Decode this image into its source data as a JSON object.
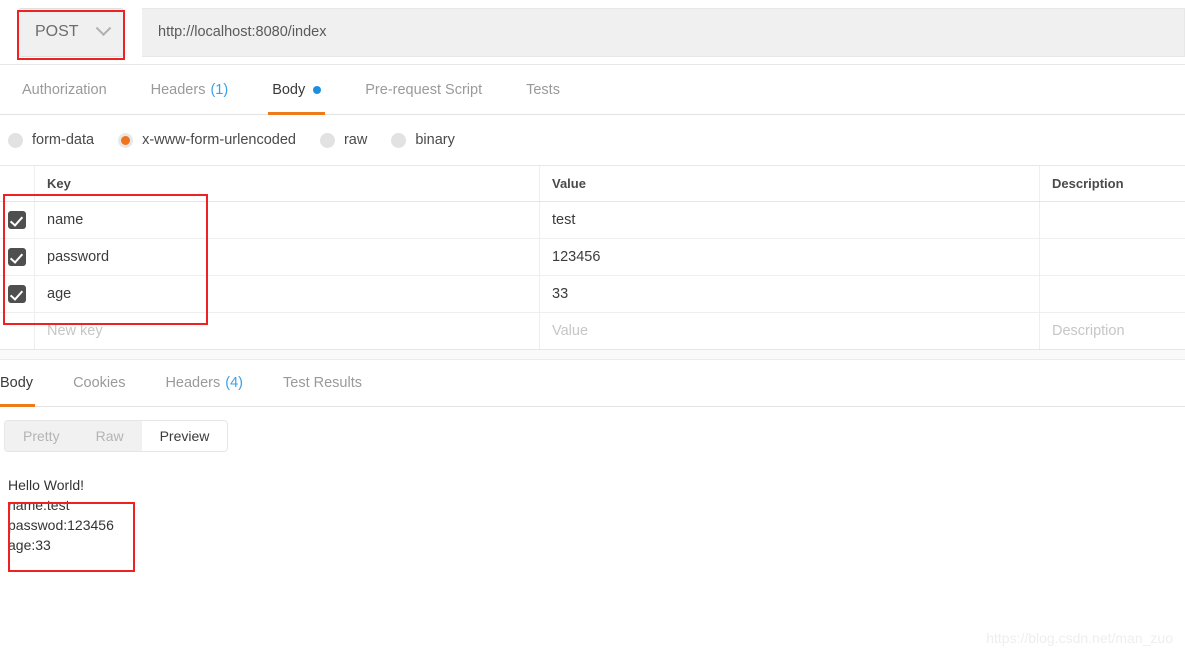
{
  "request": {
    "method": "POST",
    "method_chevron_icon": "chevron-down-icon",
    "url": "http://localhost:8080/index",
    "tabs": [
      {
        "label": "Authorization",
        "count": "",
        "active": false,
        "dot": false
      },
      {
        "label": "Headers",
        "count": "(1)",
        "active": false,
        "dot": false
      },
      {
        "label": "Body",
        "count": "",
        "active": true,
        "dot": true
      },
      {
        "label": "Pre-request Script",
        "count": "",
        "active": false,
        "dot": false
      },
      {
        "label": "Tests",
        "count": "",
        "active": false,
        "dot": false
      }
    ],
    "body_types": [
      {
        "label": "form-data",
        "selected": false
      },
      {
        "label": "x-www-form-urlencoded",
        "selected": true
      },
      {
        "label": "raw",
        "selected": false
      },
      {
        "label": "binary",
        "selected": false
      }
    ],
    "table": {
      "headers": {
        "key": "Key",
        "value": "Value",
        "description": "Description"
      },
      "rows": [
        {
          "checked": true,
          "key": "name",
          "value": "test",
          "description": ""
        },
        {
          "checked": true,
          "key": "password",
          "value": "123456",
          "description": ""
        },
        {
          "checked": true,
          "key": "age",
          "value": "33",
          "description": ""
        }
      ],
      "placeholder_row": {
        "key": "New key",
        "value": "Value",
        "description": "Description"
      }
    }
  },
  "response": {
    "tabs": [
      {
        "label": "Body",
        "count": "",
        "active": true
      },
      {
        "label": "Cookies",
        "count": "",
        "active": false
      },
      {
        "label": "Headers",
        "count": "(4)",
        "active": false
      },
      {
        "label": "Test Results",
        "count": "",
        "active": false
      }
    ],
    "view_modes": [
      {
        "label": "Pretty",
        "active": false
      },
      {
        "label": "Raw",
        "active": false
      },
      {
        "label": "Preview",
        "active": true
      }
    ],
    "body_lines": [
      "Hello World!",
      "name:test",
      "passwod:123456",
      "age:33"
    ]
  },
  "watermark": "https://blog.csdn.net/man_zuo",
  "colors": {
    "accent_orange": "#ef7a1a",
    "radio_orange": "#f0741f",
    "tab_dot_blue": "#1e8fe0",
    "count_blue": "#3aa0e8",
    "annotation_red": "#ee2222",
    "checkbox_gray": "#4f4f4f"
  }
}
